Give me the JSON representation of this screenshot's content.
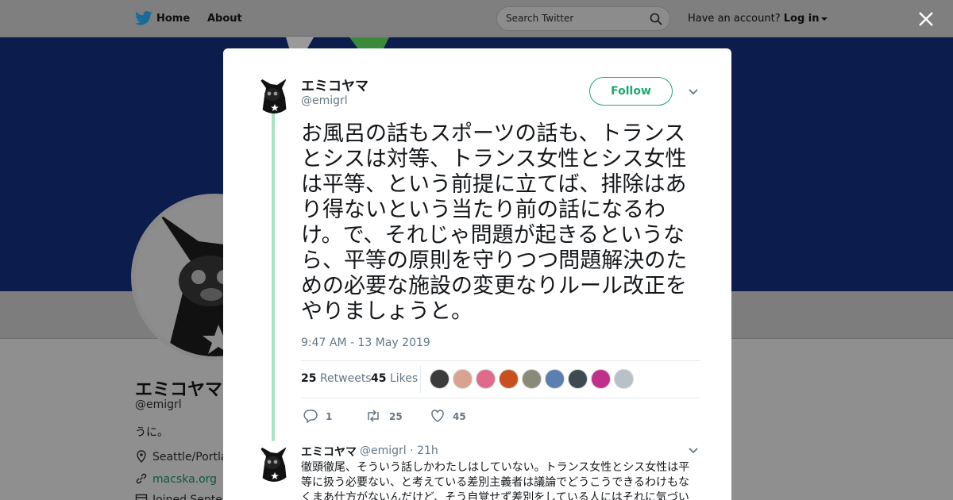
{
  "topbar": {
    "home_label": "Home",
    "about_label": "About",
    "search_placeholder": "Search Twitter",
    "account_prompt": "Have an account?",
    "login_label": "Log in"
  },
  "profile": {
    "name": "エミコヤマ",
    "handle": "@emigrl",
    "bio": "うに。",
    "location": "Seattle/Portland",
    "link": "macska.org",
    "joined": "Joined Septem"
  },
  "tweet": {
    "display_name": "エミコヤマ",
    "handle": "@emigrl",
    "follow_label": "Follow",
    "text": "お風呂の話もスポーツの話も、トランスとシスは対等、トランス女性とシス女性は平等、という前提に立てば、排除はあり得ないという当たり前の話になるわけ。で、それじゃ問題が起きるというなら、平等の原則を守りつつ問題解決のための必要な施設の変更なりルール改正をやりましょうと。",
    "timestamp": "9:47 AM - 13 May 2019",
    "retweets_count": "25",
    "retweets_label": "Retweets",
    "likes_count": "45",
    "likes_label": "Likes",
    "reply_count": "1",
    "retweet_action_count": "25",
    "like_action_count": "45",
    "liker_avatar_colors": [
      "#3b3b3b",
      "#d9a38f",
      "#e06a8a",
      "#c8501e",
      "#8a8a7a",
      "#5a7fb0",
      "#3e4a52",
      "#c0308a",
      "#b8c0c8"
    ]
  },
  "reply": {
    "display_name": "エミコヤマ",
    "handle": "@emigrl",
    "time": "· 21h",
    "text": "徹頭徹尾、そういう話しかわたしはしていない。トランス女性とシス女性は平等に扱う必要ない、と考えている差別主義者は議論でどうこうできるわけもなくまあ仕方がないんだけど、そう自覚せず差別をしている人にはそれに気づい"
  },
  "colors": {
    "accent": "#1da971",
    "thread_line": "#a6e3c6",
    "banner": "#0b1c4d",
    "overlay_gray": "#8f8f8f"
  }
}
